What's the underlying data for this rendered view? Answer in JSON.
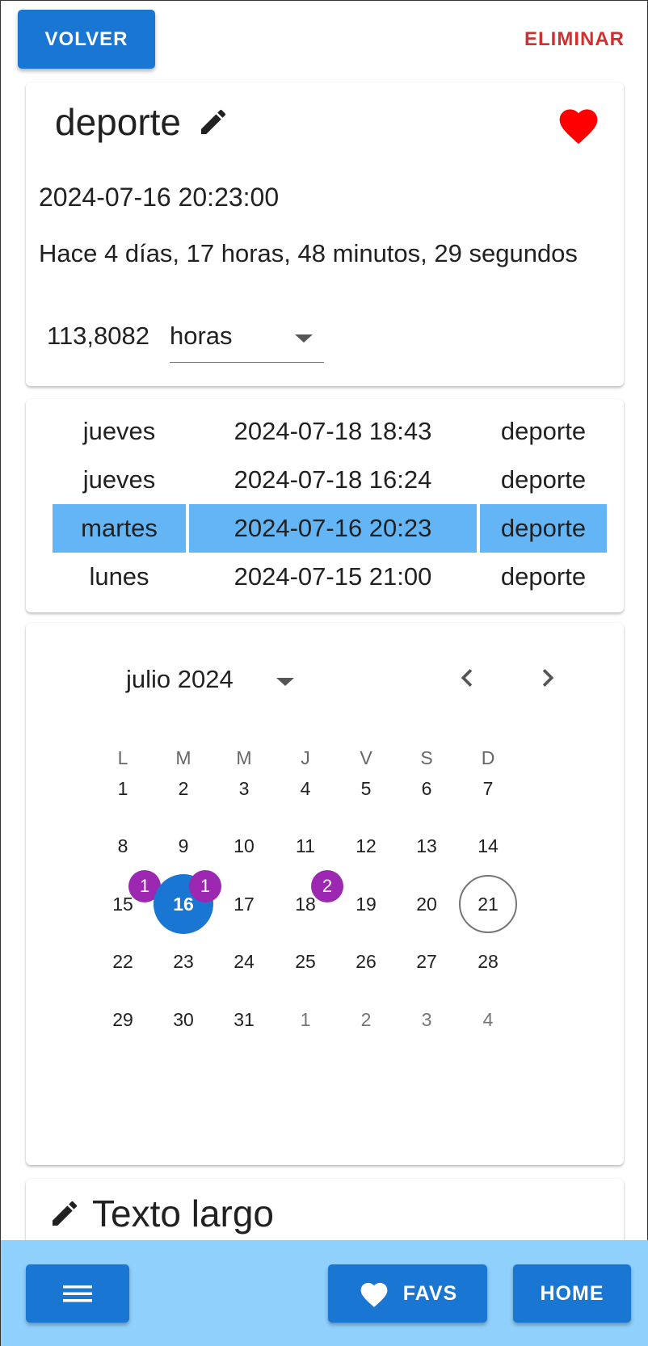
{
  "topbar": {
    "back_label": "VOLVER",
    "delete_label": "ELIMINAR"
  },
  "event": {
    "title": "deporte",
    "datetime": "2024-07-16 20:23:00",
    "elapsed": "Hace 4 días, 17 horas, 48 minutos, 29 segundos",
    "amount": "113,8082",
    "unit": "horas",
    "favorite": true
  },
  "history": [
    {
      "weekday": "jueves",
      "datetime": "2024-07-18 18:43",
      "name": "deporte",
      "selected": false
    },
    {
      "weekday": "jueves",
      "datetime": "2024-07-18 16:24",
      "name": "deporte",
      "selected": false
    },
    {
      "weekday": "martes",
      "datetime": "2024-07-16 20:23",
      "name": "deporte",
      "selected": true
    },
    {
      "weekday": "lunes",
      "datetime": "2024-07-15 21:00",
      "name": "deporte",
      "selected": false
    }
  ],
  "calendar": {
    "month_label": "julio 2024",
    "weekdays": [
      "L",
      "M",
      "M",
      "J",
      "V",
      "S",
      "D"
    ],
    "weeks": [
      [
        "1",
        "2",
        "3",
        "4",
        "5",
        "6",
        "7"
      ],
      [
        "8",
        "9",
        "10",
        "11",
        "12",
        "13",
        "14"
      ],
      [
        "15",
        "16",
        "17",
        "18",
        "19",
        "20",
        "21"
      ],
      [
        "22",
        "23",
        "24",
        "25",
        "26",
        "27",
        "28"
      ],
      [
        "29",
        "30",
        "31",
        "1",
        "2",
        "3",
        "4"
      ]
    ],
    "selected_day": "16",
    "today": "21",
    "event_counts": {
      "15": "1",
      "16": "1",
      "18": "2"
    }
  },
  "notes": {
    "title": "Texto largo"
  },
  "bottombar": {
    "favs_label": "FAVS",
    "home_label": "HOME"
  },
  "colors": {
    "primary": "#1976d2",
    "danger": "#d32f2f",
    "heart": "#ff0000",
    "highlight": "#64b5f6",
    "badge": "#9c27b0",
    "bottombar": "#90d0fc"
  },
  "icons": {
    "title_edit": "pencil-icon",
    "favorite": "heart-icon",
    "unit_dropdown": "triangle-down-icon",
    "prev_month": "chevron-left-icon",
    "next_month": "chevron-right-icon",
    "menu": "hamburger-menu-icon",
    "favs": "heart-icon"
  }
}
